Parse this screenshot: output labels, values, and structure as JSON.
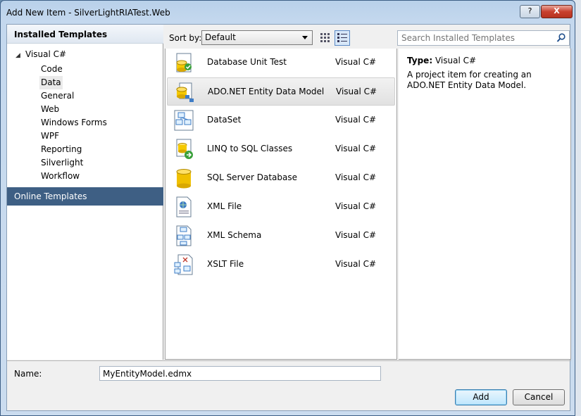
{
  "window": {
    "title": "Add New Item - SilverLightRIATest.Web",
    "help_label": "?",
    "close_label": "X"
  },
  "left_panel": {
    "installed_header": "Installed Templates",
    "root": "Visual C#",
    "items": [
      "Code",
      "Data",
      "General",
      "Web",
      "Windows Forms",
      "WPF",
      "Reporting",
      "Silverlight",
      "Workflow"
    ],
    "selected_item": "Data",
    "online": "Online Templates"
  },
  "toolbar": {
    "sort_label": "Sort by:",
    "sort_value": "Default",
    "search_placeholder": "Search Installed Templates"
  },
  "templates": [
    {
      "name": "Database Unit Test",
      "lang": "Visual C#",
      "icon": "database-unit-test-icon"
    },
    {
      "name": "ADO.NET Entity Data Model",
      "lang": "Visual C#",
      "icon": "entity-data-model-icon"
    },
    {
      "name": "DataSet",
      "lang": "Visual C#",
      "icon": "dataset-icon"
    },
    {
      "name": "LINQ to SQL Classes",
      "lang": "Visual C#",
      "icon": "linq-to-sql-icon"
    },
    {
      "name": "SQL Server Database",
      "lang": "Visual C#",
      "icon": "sql-database-icon"
    },
    {
      "name": "XML File",
      "lang": "Visual C#",
      "icon": "xml-file-icon"
    },
    {
      "name": "XML Schema",
      "lang": "Visual C#",
      "icon": "xml-schema-icon"
    },
    {
      "name": "XSLT File",
      "lang": "Visual C#",
      "icon": "xslt-file-icon"
    }
  ],
  "selected_template": "ADO.NET Entity Data Model",
  "info": {
    "type_label": "Type:",
    "type_value": "Visual C#",
    "description": "A project item for creating an ADO.NET Entity Data Model."
  },
  "bottom": {
    "name_label": "Name:",
    "name_value": "MyEntityModel.edmx",
    "add_label": "Add",
    "cancel_label": "Cancel"
  }
}
